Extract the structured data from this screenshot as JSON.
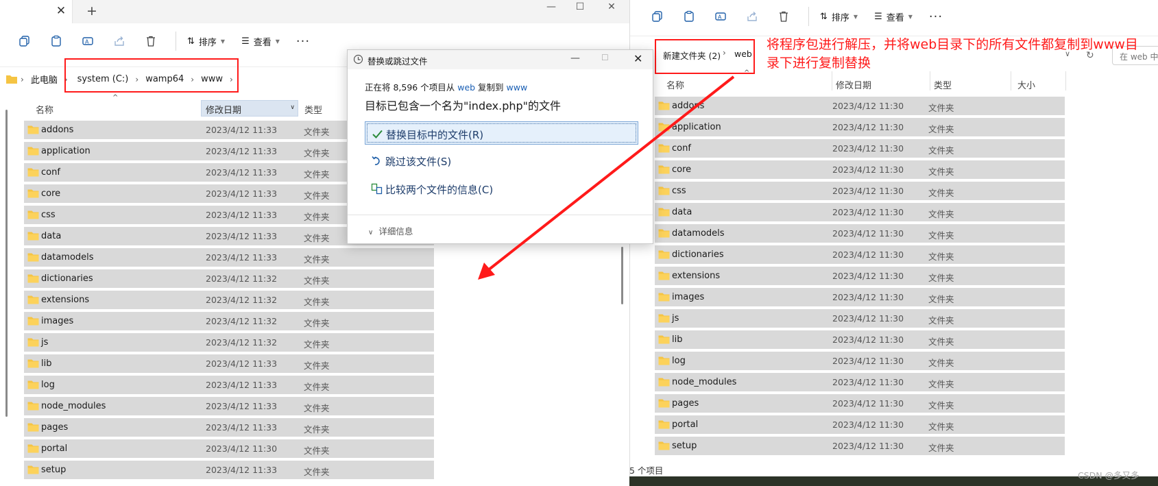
{
  "left_window": {
    "tab_close": "✕",
    "tab_new": "+",
    "window_controls": [
      "—",
      "☐",
      "✕"
    ],
    "toolbar": {
      "sort_label": "排序",
      "view_label": "查看",
      "more_label": "···"
    },
    "address": {
      "root": "此电脑",
      "segments": [
        "system (C:)",
        "wamp64",
        "www"
      ]
    },
    "columns": {
      "name": "名称",
      "date": "修改日期",
      "type": "类型"
    },
    "rows": [
      {
        "name": "addons",
        "date": "2023/4/12 11:33",
        "type": "文件夹"
      },
      {
        "name": "application",
        "date": "2023/4/12 11:33",
        "type": "文件夹"
      },
      {
        "name": "conf",
        "date": "2023/4/12 11:33",
        "type": "文件夹"
      },
      {
        "name": "core",
        "date": "2023/4/12 11:33",
        "type": "文件夹"
      },
      {
        "name": "css",
        "date": "2023/4/12 11:33",
        "type": "文件夹"
      },
      {
        "name": "data",
        "date": "2023/4/12 11:33",
        "type": "文件夹"
      },
      {
        "name": "datamodels",
        "date": "2023/4/12 11:33",
        "type": "文件夹"
      },
      {
        "name": "dictionaries",
        "date": "2023/4/12 11:32",
        "type": "文件夹"
      },
      {
        "name": "extensions",
        "date": "2023/4/12 11:32",
        "type": "文件夹"
      },
      {
        "name": "images",
        "date": "2023/4/12 11:32",
        "type": "文件夹"
      },
      {
        "name": "js",
        "date": "2023/4/12 11:32",
        "type": "文件夹"
      },
      {
        "name": "lib",
        "date": "2023/4/12 11:33",
        "type": "文件夹"
      },
      {
        "name": "log",
        "date": "2023/4/12 11:33",
        "type": "文件夹"
      },
      {
        "name": "node_modules",
        "date": "2023/4/12 11:33",
        "type": "文件夹"
      },
      {
        "name": "pages",
        "date": "2023/4/12 11:33",
        "type": "文件夹"
      },
      {
        "name": "portal",
        "date": "2023/4/12 11:30",
        "type": "文件夹"
      },
      {
        "name": "setup",
        "date": "2023/4/12 11:33",
        "type": "文件夹"
      }
    ]
  },
  "right_window": {
    "toolbar": {
      "sort_label": "排序",
      "view_label": "查看",
      "more_label": "···"
    },
    "address": {
      "segments": [
        "新建文件夹 (2)",
        "web"
      ]
    },
    "search_placeholder": "在 web 中",
    "columns": {
      "name": "名称",
      "date": "修改日期",
      "type": "类型",
      "size": "大小"
    },
    "status_text": "5 个项目",
    "rows": [
      {
        "name": "addons",
        "date": "2023/4/12 11:30",
        "type": "文件夹"
      },
      {
        "name": "application",
        "date": "2023/4/12 11:30",
        "type": "文件夹"
      },
      {
        "name": "conf",
        "date": "2023/4/12 11:30",
        "type": "文件夹"
      },
      {
        "name": "core",
        "date": "2023/4/12 11:30",
        "type": "文件夹"
      },
      {
        "name": "css",
        "date": "2023/4/12 11:30",
        "type": "文件夹"
      },
      {
        "name": "data",
        "date": "2023/4/12 11:30",
        "type": "文件夹"
      },
      {
        "name": "datamodels",
        "date": "2023/4/12 11:30",
        "type": "文件夹"
      },
      {
        "name": "dictionaries",
        "date": "2023/4/12 11:30",
        "type": "文件夹"
      },
      {
        "name": "extensions",
        "date": "2023/4/12 11:30",
        "type": "文件夹"
      },
      {
        "name": "images",
        "date": "2023/4/12 11:30",
        "type": "文件夹"
      },
      {
        "name": "js",
        "date": "2023/4/12 11:30",
        "type": "文件夹"
      },
      {
        "name": "lib",
        "date": "2023/4/12 11:30",
        "type": "文件夹"
      },
      {
        "name": "log",
        "date": "2023/4/12 11:30",
        "type": "文件夹"
      },
      {
        "name": "node_modules",
        "date": "2023/4/12 11:30",
        "type": "文件夹"
      },
      {
        "name": "pages",
        "date": "2023/4/12 11:30",
        "type": "文件夹"
      },
      {
        "name": "portal",
        "date": "2023/4/12 11:30",
        "type": "文件夹"
      },
      {
        "name": "setup",
        "date": "2023/4/12 11:30",
        "type": "文件夹"
      }
    ]
  },
  "dialog": {
    "title": "替换或跳过文件",
    "progress_prefix": "正在将 8,596 个项目从 ",
    "progress_source": "web",
    "progress_middle": " 复制到 ",
    "progress_dest": "www",
    "heading": "目标已包含一个名为\"index.php\"的文件",
    "option_replace": "替换目标中的文件(R)",
    "option_skip": "跳过该文件(S)",
    "option_compare": "比较两个文件的信息(C)",
    "details": "详细信息"
  },
  "annotation": {
    "text": "将程序包进行解压，并将web目录下的所有文件都复制到www目录下进行复制替换",
    "color": "#ff1a1a"
  },
  "watermark": "CSDN @多又多",
  "colors": {
    "row_bg": "#d9d9d9",
    "accent": "#1a5fb4",
    "annotation_red": "#ff1a1a",
    "folder": "#f5c443"
  }
}
